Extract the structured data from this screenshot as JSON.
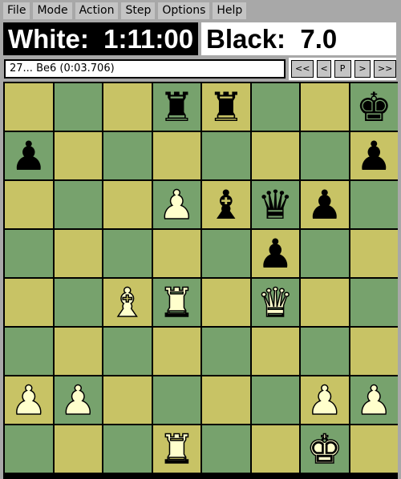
{
  "menu": [
    "File",
    "Mode",
    "Action",
    "Step",
    "Options",
    "Help"
  ],
  "clocks": {
    "white": "White:  1:11:00",
    "black": "Black:  7.0"
  },
  "status": "27... Be6 (0:03.706)",
  "nav_buttons": [
    "<<",
    "<",
    "P",
    ">",
    ">>"
  ],
  "colors": {
    "light_square": "#c8c365",
    "dark_square": "#77a26d",
    "white_piece": "#ffffcc",
    "black_piece": "#000000"
  },
  "board": [
    [
      "",
      "",
      "",
      "r",
      "r",
      "",
      "",
      "k"
    ],
    [
      "p",
      "",
      "",
      "",
      "",
      "",
      "",
      "p"
    ],
    [
      "",
      "",
      "",
      "P",
      "b",
      "q",
      "p",
      ""
    ],
    [
      "",
      "",
      "",
      "",
      "",
      "p",
      "",
      ""
    ],
    [
      "",
      "",
      "B",
      "R",
      "",
      "Q",
      "",
      ""
    ],
    [
      "",
      "",
      "",
      "",
      "",
      "",
      "",
      ""
    ],
    [
      "P",
      "P",
      "",
      "",
      "",
      "",
      "P",
      "P"
    ],
    [
      "",
      "",
      "",
      "R",
      "",
      "",
      "K",
      ""
    ]
  ]
}
